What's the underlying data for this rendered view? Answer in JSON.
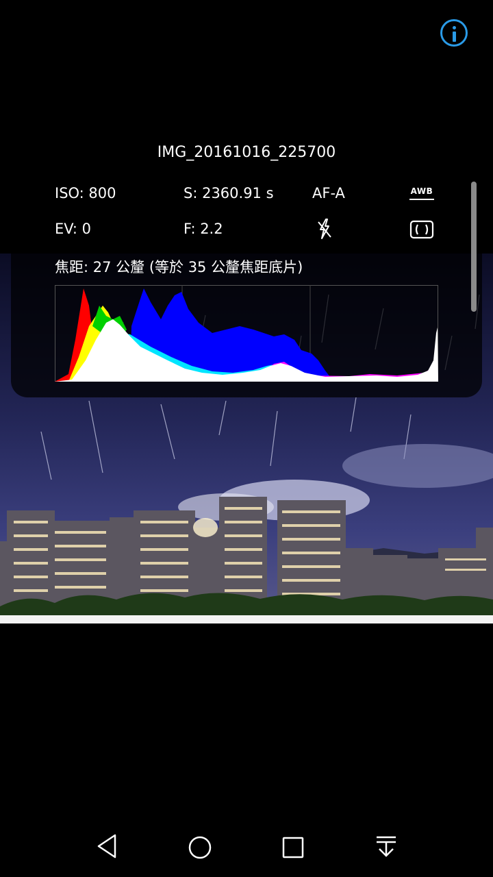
{
  "file": {
    "name": "IMG_20161016_225700"
  },
  "exif": {
    "iso": "ISO: 800",
    "shutter": "S: 2360.91 s",
    "focus_mode": "AF-A",
    "white_balance": "AWB",
    "ev": "EV: 0",
    "aperture": "F: 2.2",
    "focal_length": "焦距: 27 公釐 (等於 35 公釐焦距底片)"
  },
  "icons": {
    "info": "info-icon",
    "white_balance": "awb-icon",
    "flash": "flash-off-icon",
    "metering": "metering-icon",
    "back": "back-icon",
    "home": "home-icon",
    "recents": "recents-icon",
    "notifications": "notification-pulldown-icon"
  },
  "colors": {
    "accent": "#2a9be8",
    "background": "#000000"
  }
}
